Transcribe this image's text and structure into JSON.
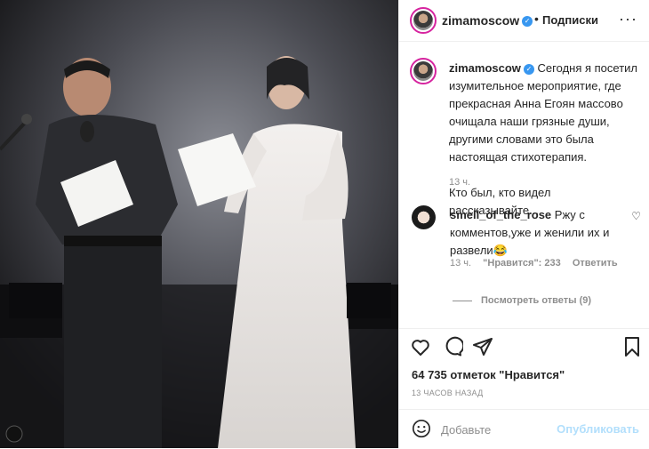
{
  "post": {
    "username": "zimamoscow",
    "dot": "•",
    "follow_label": "Подписки",
    "more_label": "···"
  },
  "caption": {
    "username": "zimamoscow",
    "text": "Сегодня я посетил изумительное мероприятие, где прекрасная Анна Егоян массово очищала наши грязные души, другими словами это была настоящая стихотерапия.",
    "text2": "Кто был, кто видел рассказывайте...",
    "time": "13 ч."
  },
  "comment": {
    "username": "smell_of_the_rose",
    "text": "Ржу с комментов,уже и женили их и развели😂",
    "time": "13 ч.",
    "likes": "\"Нравится\": 233",
    "reply_label": "Ответить",
    "view_replies": "Посмотреть ответы (9)"
  },
  "likes_text": "64 735 отметок \"Нравится\"",
  "posted_ago": "13 ЧАСОВ НАЗАД",
  "add_comment": {
    "placeholder": "Добавьте",
    "publish_label": "Опубликовать"
  },
  "colors": {
    "verified": "#3897f0",
    "muted": "#8e8e8e",
    "publish_disabled": "#b2dffc"
  },
  "icons": [
    "heart-icon",
    "comment-icon",
    "share-icon",
    "bookmark-icon",
    "emoji-icon",
    "more-icon",
    "verified-icon"
  ]
}
